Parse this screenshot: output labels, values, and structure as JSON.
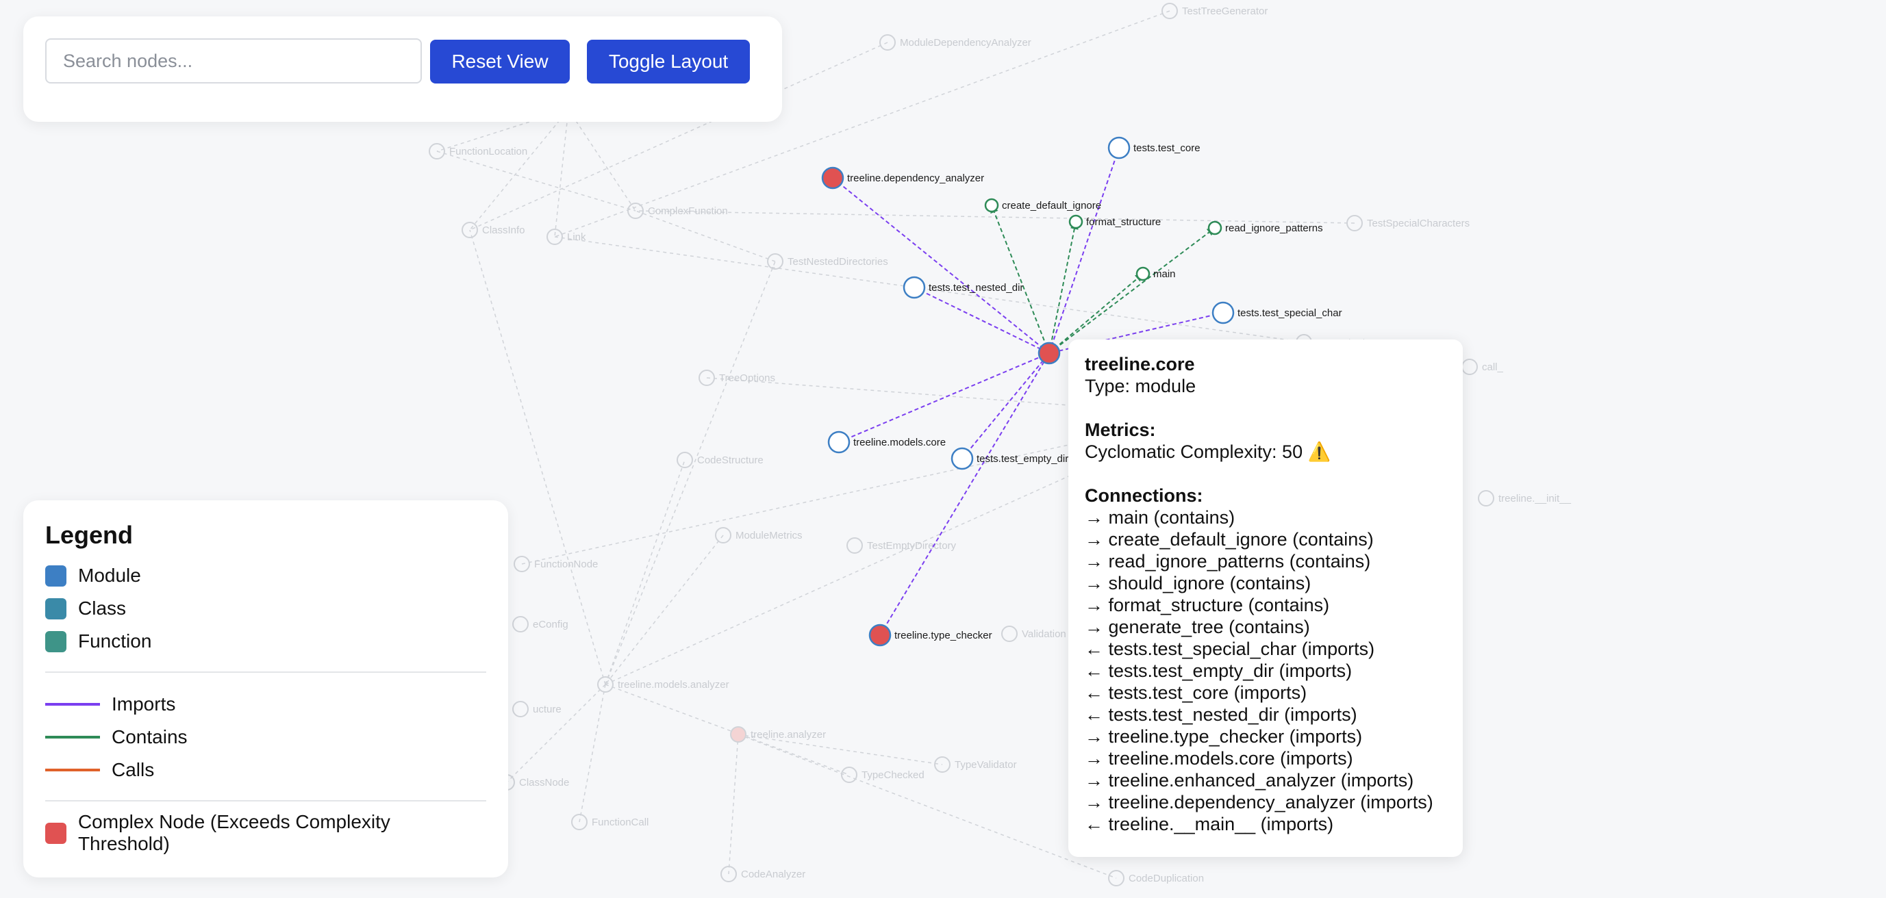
{
  "controls": {
    "search_placeholder": "Search nodes...",
    "reset_label": "Reset View",
    "toggle_label": "Toggle Layout"
  },
  "legend": {
    "title": "Legend",
    "node_types": [
      {
        "label": "Module",
        "color": "#3d7fc4"
      },
      {
        "label": "Class",
        "color": "#3a8aa8"
      },
      {
        "label": "Function",
        "color": "#3e9488"
      }
    ],
    "edge_types": [
      {
        "label": "Imports",
        "color": "#7b3ff0"
      },
      {
        "label": "Contains",
        "color": "#2e8b57"
      },
      {
        "label": "Calls",
        "color": "#e0622a"
      }
    ],
    "complex": {
      "label": "Complex Node (Exceeds Complexity Threshold)",
      "color": "#e05252"
    }
  },
  "tooltip": {
    "title": "treeline.core",
    "type_line": "Type: module",
    "metrics_heading": "Metrics:",
    "complexity_line": "Cyclomatic Complexity: 50",
    "warning_glyph": "⚠️",
    "connections_heading": "Connections:",
    "connections": [
      "→ main (contains)",
      "→ create_default_ignore (contains)",
      "→ read_ignore_patterns (contains)",
      "→ should_ignore (contains)",
      "→ format_structure (contains)",
      "→ generate_tree (contains)",
      "← tests.test_special_char (imports)",
      "← tests.test_empty_dir (imports)",
      "← tests.test_core (imports)",
      "← tests.test_nested_dir (imports)",
      "→ treeline.type_checker (imports)",
      "→ treeline.models.core (imports)",
      "→ treeline.enhanced_analyzer (imports)",
      "→ treeline.dependency_analyzer (imports)",
      "← treeline.__main__ (imports)"
    ]
  },
  "graph": {
    "colors": {
      "module_stroke": "#3d7fc4",
      "function_stroke": "#2e8b57",
      "complex_fill": "#e05252",
      "imports_edge": "#7b3ff0",
      "contains_edge": "#2e8b57",
      "faded": "#d0d3d8"
    },
    "highlighted_nodes": [
      {
        "id": "core",
        "label": "",
        "kind": "complex"
      },
      {
        "id": "dep",
        "label": "treeline.dependency_analyzer",
        "kind": "complex"
      },
      {
        "id": "tc",
        "label": "treeline.type_checker",
        "kind": "complex"
      },
      {
        "id": "ttc",
        "label": "tests.test_core",
        "kind": "module"
      },
      {
        "id": "tnd",
        "label": "tests.test_nested_dir",
        "kind": "module"
      },
      {
        "id": "tsc",
        "label": "tests.test_special_char",
        "kind": "module"
      },
      {
        "id": "tmc",
        "label": "treeline.models.core",
        "kind": "module"
      },
      {
        "id": "ted",
        "label": "tests.test_empty_dir",
        "kind": "module"
      },
      {
        "id": "cdi",
        "label": "create_default_ignore",
        "kind": "function"
      },
      {
        "id": "fs",
        "label": "format_structure",
        "kind": "function"
      },
      {
        "id": "rip",
        "label": "read_ignore_patterns",
        "kind": "function"
      },
      {
        "id": "main",
        "label": "main",
        "kind": "function"
      }
    ],
    "faded_nodes": [
      {
        "label": "TestTreeGenerator"
      },
      {
        "label": "ModuleDependencyAnalyzer"
      },
      {
        "label": "FunctionLocation"
      },
      {
        "label": "ComplexFunction"
      },
      {
        "label": "ClassInfo"
      },
      {
        "label": "Link"
      },
      {
        "label": "TestNestedDirectories"
      },
      {
        "label": "TestSpecialCharacters"
      },
      {
        "label": "generate_tree"
      },
      {
        "label": "TreeOptions"
      },
      {
        "label": "should_ignore"
      },
      {
        "label": "CodeStructure"
      },
      {
        "label": "ModuleMetrics"
      },
      {
        "label": "TestEmptyDirectory"
      },
      {
        "label": "FunctionNode"
      },
      {
        "label": "treeline.models.analyzer"
      },
      {
        "label": "treeline.analyzer"
      },
      {
        "label": "TypeChecked"
      },
      {
        "label": "TypeValidator"
      },
      {
        "label": "ClassNode"
      },
      {
        "label": "FunctionCall"
      },
      {
        "label": "CodeAnalyzer"
      },
      {
        "label": "CodeDuplication"
      },
      {
        "label": "treeline.__init__"
      },
      {
        "label": "Validation"
      },
      {
        "label": "call_"
      },
      {
        "label": "eConfig"
      },
      {
        "label": "ucture"
      }
    ]
  }
}
